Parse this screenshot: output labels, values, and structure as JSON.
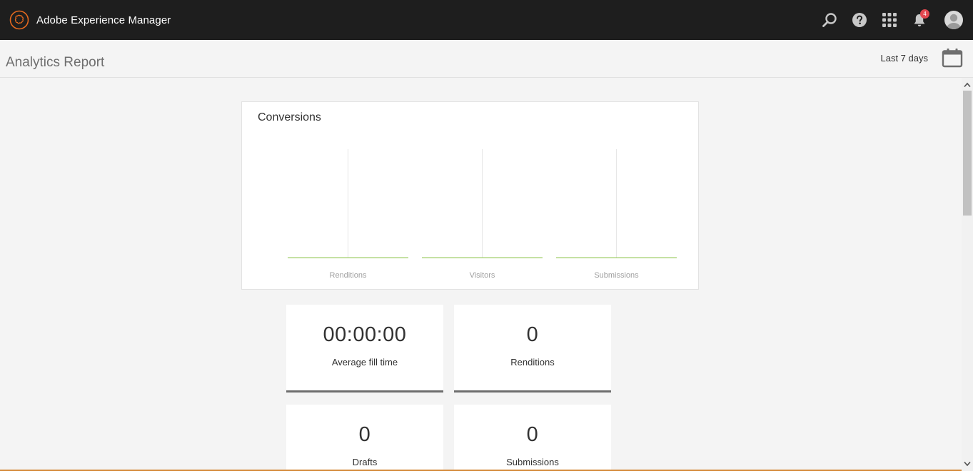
{
  "app": {
    "name": "Adobe Experience Manager",
    "logo_icon": "adobe-experience-manager-logo"
  },
  "shell": {
    "search_icon": "search-icon",
    "help_icon": "help-icon",
    "apps_icon": "apps-grid-icon",
    "notifications_icon": "bell-icon",
    "notifications_count": "4",
    "avatar_icon": "user-avatar-icon"
  },
  "page": {
    "title": "Analytics Report",
    "date_range": "Last 7 days",
    "calendar_icon": "calendar-icon"
  },
  "chart_data": {
    "type": "bar",
    "title": "Conversions",
    "categories": [
      "Renditions",
      "Visitors",
      "Submissions"
    ],
    "values": [
      0,
      0,
      0
    ],
    "xlabel": "",
    "ylabel": "",
    "grid": false,
    "legend": "none",
    "baseline_color": "#8bc34a",
    "divider_color": "#e6e6e6"
  },
  "tiles": [
    {
      "value": "00:00:00",
      "label": "Average fill time"
    },
    {
      "value": "0",
      "label": "Renditions"
    },
    {
      "value": "0",
      "label": "Drafts"
    },
    {
      "value": "0",
      "label": "Submissions"
    }
  ],
  "colors": {
    "shell_bg": "#1e1e1e",
    "badge": "#e34850",
    "logo_ring": "#e5691e",
    "tile_underline": "#6e6e6e"
  }
}
